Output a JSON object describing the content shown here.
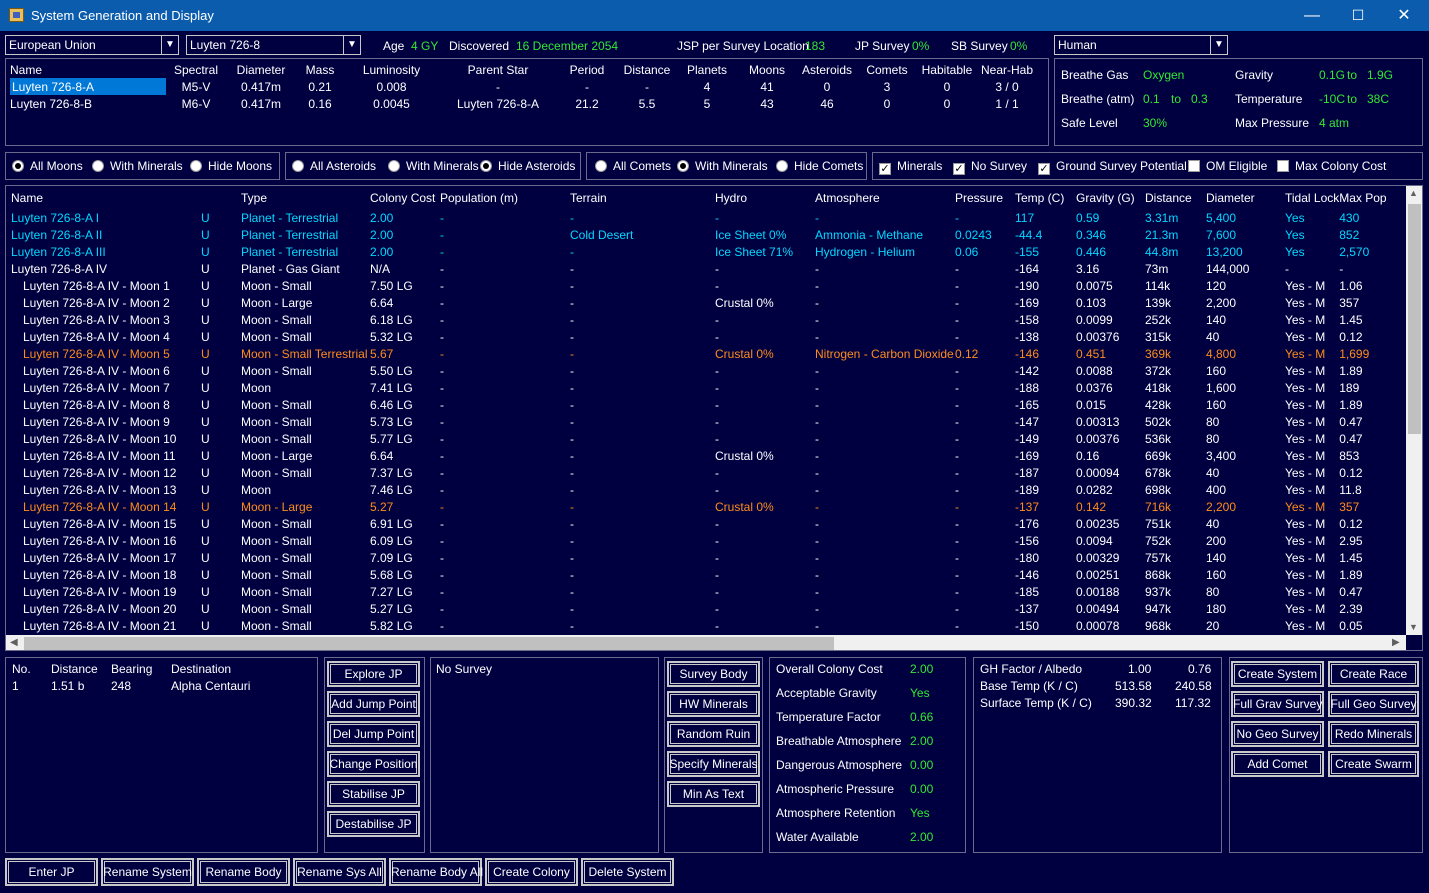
{
  "window": {
    "title": "System Generation and Display",
    "minimize": "—",
    "maximize": "☐",
    "close": "✕"
  },
  "top": {
    "race": "European Union",
    "system": "Luyten 726-8",
    "age_label": "Age",
    "age_value": "4 GY",
    "discovered_label": "Discovered",
    "discovered_value": "16 December 2054",
    "jsp_label": "JSP per Survey Location",
    "jsp_value": "183",
    "jp_survey_label": "JP Survey",
    "jp_survey_value": "0%",
    "sb_survey_label": "SB Survey",
    "sb_survey_value": "0%",
    "species": "Human"
  },
  "stars": {
    "headers": [
      "Name",
      "Spectral",
      "Diameter",
      "Mass",
      "Luminosity",
      "Parent Star",
      "Period",
      "Distance",
      "Planets",
      "Moons",
      "Asteroids",
      "Comets",
      "Habitable",
      "Near-Hab"
    ],
    "rows": [
      [
        "Luyten 726-8-A",
        "M5-V",
        "0.417m",
        "0.21",
        "0.008",
        "-",
        "-",
        "-",
        "4",
        "41",
        "0",
        "3",
        "0",
        "3 / 0"
      ],
      [
        "Luyten 726-8-B",
        "M6-V",
        "0.417m",
        "0.16",
        "0.0045",
        "Luyten 726-8-A",
        "21.2",
        "5.5",
        "5",
        "43",
        "46",
        "0",
        "0",
        "1 / 1"
      ]
    ]
  },
  "env": {
    "breathe_gas_label": "Breathe Gas",
    "breathe_gas_value": "Oxygen",
    "breathe_atm_label": "Breathe (atm)",
    "breathe_atm_min": "0.1",
    "breathe_atm_to": "to",
    "breathe_atm_max": "0.3",
    "safe_level_label": "Safe Level",
    "safe_level_value": "30%",
    "gravity_label": "Gravity",
    "gravity_min": "0.1G",
    "gravity_to": "to",
    "gravity_max": "1.9G",
    "temperature_label": "Temperature",
    "temp_min": "-10C",
    "temp_to": "to",
    "temp_max": "38C",
    "max_pressure_label": "Max Pressure",
    "max_pressure_value": "4 atm"
  },
  "filters": {
    "moons": [
      "All Moons",
      "With Minerals",
      "Hide Moons"
    ],
    "asteroids": [
      "All Asteroids",
      "With Minerals",
      "Hide Asteroids"
    ],
    "comets": [
      "All Comets",
      "With Minerals",
      "Hide Comets"
    ],
    "checks": [
      "Minerals",
      "No Survey",
      "Ground Survey Potential",
      "OM Eligible",
      "Max Colony Cost"
    ]
  },
  "bodies": {
    "headers": [
      "Name",
      "",
      "Type",
      "Colony Cost",
      "Population (m)",
      "Terrain",
      "Hydro",
      "Atmosphere",
      "Pressure",
      "Temp (C)",
      "Gravity (G)",
      "Distance",
      "Diameter",
      "Tidal Lock",
      "Max Pop"
    ],
    "rows": [
      {
        "c": "cy",
        "v": [
          "Luyten 726-8-A I",
          "U",
          "Planet - Terrestrial",
          "2.00",
          "-",
          "-",
          "-",
          "-",
          "-",
          "117",
          "0.59",
          "3.31m",
          "5,400",
          "Yes",
          "430"
        ]
      },
      {
        "c": "cy",
        "v": [
          "Luyten 726-8-A II",
          "U",
          "Planet - Terrestrial",
          "2.00",
          "-",
          "Cold Desert",
          "Ice Sheet 0%",
          "Ammonia - Methane",
          "0.0243",
          "-44.4",
          "0.346",
          "21.3m",
          "7,600",
          "Yes",
          "852"
        ]
      },
      {
        "c": "cy",
        "v": [
          "Luyten 726-8-A III",
          "U",
          "Planet - Terrestrial",
          "2.00",
          "-",
          "-",
          "Ice Sheet 71%",
          "Hydrogen - Helium",
          "0.06",
          "-155",
          "0.446",
          "44.8m",
          "13,200",
          "Yes",
          "2,570"
        ]
      },
      {
        "c": "w",
        "v": [
          "Luyten 726-8-A IV",
          "U",
          "Planet - Gas Giant",
          "N/A",
          "-",
          "-",
          "-",
          "-",
          "-",
          "-164",
          "3.16",
          "73m",
          "144,000",
          "-",
          "-"
        ]
      },
      {
        "c": "w",
        "i": 1,
        "v": [
          "Luyten 726-8-A IV - Moon 1",
          "U",
          "Moon - Small",
          "7.50 LG",
          "-",
          "-",
          "-",
          "-",
          "-",
          "-190",
          "0.0075",
          "114k",
          "120",
          "Yes - M",
          "1.06"
        ]
      },
      {
        "c": "w",
        "i": 1,
        "v": [
          "Luyten 726-8-A IV - Moon 2",
          "U",
          "Moon - Large",
          "6.64",
          "-",
          "-",
          "Crustal 0%",
          "-",
          "-",
          "-169",
          "0.103",
          "139k",
          "2,200",
          "Yes - M",
          "357"
        ]
      },
      {
        "c": "w",
        "i": 1,
        "v": [
          "Luyten 726-8-A IV - Moon 3",
          "U",
          "Moon - Small",
          "6.18 LG",
          "-",
          "-",
          "-",
          "-",
          "-",
          "-158",
          "0.0099",
          "252k",
          "140",
          "Yes - M",
          "1.45"
        ]
      },
      {
        "c": "w",
        "i": 1,
        "v": [
          "Luyten 726-8-A IV - Moon 4",
          "U",
          "Moon - Small",
          "5.32 LG",
          "-",
          "-",
          "-",
          "-",
          "-",
          "-138",
          "0.00376",
          "315k",
          "40",
          "Yes - M",
          "0.12"
        ]
      },
      {
        "c": "org",
        "i": 1,
        "v": [
          "Luyten 726-8-A IV - Moon 5",
          "U",
          "Moon - Small Terrestrial",
          "5.67",
          "-",
          "-",
          "Crustal 0%",
          "Nitrogen - Carbon Dioxide",
          "0.12",
          "-146",
          "0.451",
          "369k",
          "4,800",
          "Yes - M",
          "1,699"
        ]
      },
      {
        "c": "w",
        "i": 1,
        "v": [
          "Luyten 726-8-A IV - Moon 6",
          "U",
          "Moon - Small",
          "5.50 LG",
          "-",
          "-",
          "-",
          "-",
          "-",
          "-142",
          "0.0088",
          "372k",
          "160",
          "Yes - M",
          "1.89"
        ]
      },
      {
        "c": "w",
        "i": 1,
        "v": [
          "Luyten 726-8-A IV - Moon 7",
          "U",
          "Moon",
          "7.41 LG",
          "-",
          "-",
          "-",
          "-",
          "-",
          "-188",
          "0.0376",
          "418k",
          "1,600",
          "Yes - M",
          "189"
        ]
      },
      {
        "c": "w",
        "i": 1,
        "v": [
          "Luyten 726-8-A IV - Moon 8",
          "U",
          "Moon - Small",
          "6.46 LG",
          "-",
          "-",
          "-",
          "-",
          "-",
          "-165",
          "0.015",
          "428k",
          "160",
          "Yes - M",
          "1.89"
        ]
      },
      {
        "c": "w",
        "i": 1,
        "v": [
          "Luyten 726-8-A IV - Moon 9",
          "U",
          "Moon - Small",
          "5.73 LG",
          "-",
          "-",
          "-",
          "-",
          "-",
          "-147",
          "0.00313",
          "502k",
          "80",
          "Yes - M",
          "0.47"
        ]
      },
      {
        "c": "w",
        "i": 1,
        "v": [
          "Luyten 726-8-A IV - Moon 10",
          "U",
          "Moon - Small",
          "5.77 LG",
          "-",
          "-",
          "-",
          "-",
          "-",
          "-149",
          "0.00376",
          "536k",
          "80",
          "Yes - M",
          "0.47"
        ]
      },
      {
        "c": "w",
        "i": 1,
        "v": [
          "Luyten 726-8-A IV - Moon 11",
          "U",
          "Moon - Large",
          "6.64",
          "-",
          "-",
          "Crustal 0%",
          "-",
          "-",
          "-169",
          "0.16",
          "669k",
          "3,400",
          "Yes - M",
          "853"
        ]
      },
      {
        "c": "w",
        "i": 1,
        "v": [
          "Luyten 726-8-A IV - Moon 12",
          "U",
          "Moon - Small",
          "7.37 LG",
          "-",
          "-",
          "-",
          "-",
          "-",
          "-187",
          "0.00094",
          "678k",
          "40",
          "Yes - M",
          "0.12"
        ]
      },
      {
        "c": "w",
        "i": 1,
        "v": [
          "Luyten 726-8-A IV - Moon 13",
          "U",
          "Moon",
          "7.46 LG",
          "-",
          "-",
          "-",
          "-",
          "-",
          "-189",
          "0.0282",
          "698k",
          "400",
          "Yes - M",
          "11.8"
        ]
      },
      {
        "c": "org",
        "i": 1,
        "v": [
          "Luyten 726-8-A IV - Moon 14",
          "U",
          "Moon - Large",
          "5.27",
          "-",
          "-",
          "Crustal 0%",
          "-",
          "-",
          "-137",
          "0.142",
          "716k",
          "2,200",
          "Yes - M",
          "357"
        ]
      },
      {
        "c": "w",
        "i": 1,
        "v": [
          "Luyten 726-8-A IV - Moon 15",
          "U",
          "Moon - Small",
          "6.91 LG",
          "-",
          "-",
          "-",
          "-",
          "-",
          "-176",
          "0.00235",
          "751k",
          "40",
          "Yes - M",
          "0.12"
        ]
      },
      {
        "c": "w",
        "i": 1,
        "v": [
          "Luyten 726-8-A IV - Moon 16",
          "U",
          "Moon - Small",
          "6.09 LG",
          "-",
          "-",
          "-",
          "-",
          "-",
          "-156",
          "0.0094",
          "752k",
          "200",
          "Yes - M",
          "2.95"
        ]
      },
      {
        "c": "w",
        "i": 1,
        "v": [
          "Luyten 726-8-A IV - Moon 17",
          "U",
          "Moon - Small",
          "7.09 LG",
          "-",
          "-",
          "-",
          "-",
          "-",
          "-180",
          "0.00329",
          "757k",
          "140",
          "Yes - M",
          "1.45"
        ]
      },
      {
        "c": "w",
        "i": 1,
        "v": [
          "Luyten 726-8-A IV - Moon 18",
          "U",
          "Moon - Small",
          "5.68 LG",
          "-",
          "-",
          "-",
          "-",
          "-",
          "-146",
          "0.00251",
          "868k",
          "160",
          "Yes - M",
          "1.89"
        ]
      },
      {
        "c": "w",
        "i": 1,
        "v": [
          "Luyten 726-8-A IV - Moon 19",
          "U",
          "Moon - Small",
          "7.27 LG",
          "-",
          "-",
          "-",
          "-",
          "-",
          "-185",
          "0.00188",
          "937k",
          "80",
          "Yes - M",
          "0.47"
        ]
      },
      {
        "c": "w",
        "i": 1,
        "v": [
          "Luyten 726-8-A IV - Moon 20",
          "U",
          "Moon - Small",
          "5.27 LG",
          "-",
          "-",
          "-",
          "-",
          "-",
          "-137",
          "0.00494",
          "947k",
          "180",
          "Yes - M",
          "2.39"
        ]
      },
      {
        "c": "w",
        "i": 1,
        "v": [
          "Luyten 726-8-A IV - Moon 21",
          "U",
          "Moon - Small",
          "5.82 LG",
          "-",
          "-",
          "-",
          "-",
          "-",
          "-150",
          "0.00078",
          "968k",
          "20",
          "Yes - M",
          "0.05"
        ]
      }
    ]
  },
  "jumps": {
    "headers": [
      "No.",
      "Distance",
      "Bearing",
      "Destination"
    ],
    "rows": [
      [
        "1",
        "1.51 b",
        "248",
        "Alpha Centauri"
      ]
    ]
  },
  "jp_buttons": [
    "Explore JP",
    "Add Jump Point",
    "Del Jump Point",
    "Change Position",
    "Stabilise JP",
    "Destabilise JP"
  ],
  "survey_text": "No Survey",
  "survey_buttons": [
    "Survey Body",
    "HW Minerals",
    "Random Ruin",
    "Specify Minerals",
    "Min As Text"
  ],
  "colony": {
    "labels": [
      "Overall Colony Cost",
      "Acceptable Gravity",
      "Temperature Factor",
      "Breathable Atmosphere",
      "Dangerous Atmosphere",
      "Atmospheric Pressure",
      "Atmosphere Retention",
      "Water Available"
    ],
    "values": [
      "2.00",
      "Yes",
      "0.66",
      "2.00",
      "0.00",
      "0.00",
      "Yes",
      "2.00"
    ]
  },
  "ghfactor": {
    "r1_label": "GH Factor / Albedo",
    "r1_v1": "1.00",
    "r1_v2": "0.76",
    "r2_label": "Base Temp (K / C)",
    "r2_v1": "513.58",
    "r2_v2": "240.58",
    "r3_label": "Surface Temp (K / C)",
    "r3_v1": "390.32",
    "r3_v2": "117.32"
  },
  "right_buttons": [
    "Create System",
    "Create Race",
    "Full Grav Survey",
    "Full Geo Survey",
    "No Geo Survey",
    "Redo Minerals",
    "Add Comet",
    "Create Swarm"
  ],
  "bottom_buttons": [
    "Enter JP",
    "Rename System",
    "Rename Body",
    "Rename Sys All",
    "Rename Body All",
    "Create Colony",
    "Delete System"
  ]
}
